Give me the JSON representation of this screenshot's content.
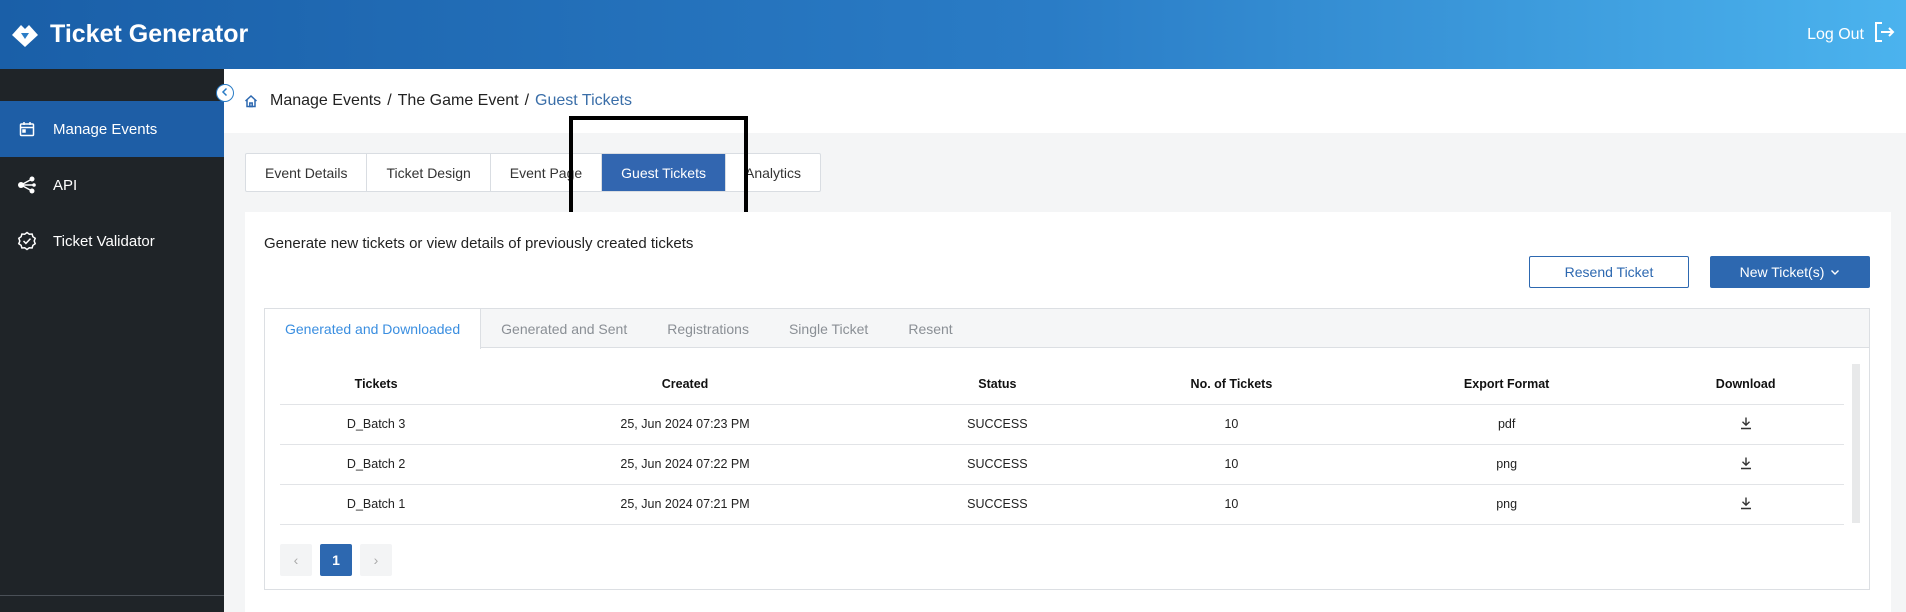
{
  "header": {
    "app_title": "Ticket Generator",
    "logout_label": "Log Out"
  },
  "sidebar": {
    "items": [
      {
        "label": "Manage Events",
        "icon": "calendar-icon",
        "active": true
      },
      {
        "label": "API",
        "icon": "share-nodes-icon",
        "active": false
      },
      {
        "label": "Ticket Validator",
        "icon": "badge-check-icon",
        "active": false
      }
    ]
  },
  "breadcrumb": {
    "part1": "Manage Events",
    "sep1": "/",
    "part2": "The Game Event",
    "sep2": "/",
    "current": "Guest Tickets"
  },
  "tabs": [
    "Event Details",
    "Ticket Design",
    "Event Page",
    "Guest Tickets",
    "Analytics"
  ],
  "active_tab": "Guest Tickets",
  "content": {
    "intro": "Generate new tickets or view details of previously created tickets",
    "resend_label": "Resend Ticket",
    "new_label": "New Ticket(s)"
  },
  "subtabs": [
    "Generated and Downloaded",
    "Generated and Sent",
    "Registrations",
    "Single Ticket",
    "Resent"
  ],
  "table": {
    "headers": [
      "Tickets",
      "Created",
      "Status",
      "No. of Tickets",
      "Export Format",
      "Download"
    ],
    "rows": [
      {
        "ticket": "D_Batch 3",
        "created": "25, Jun 2024 07:23 PM",
        "status": "SUCCESS",
        "count": "10",
        "format": "pdf"
      },
      {
        "ticket": "D_Batch 2",
        "created": "25, Jun 2024 07:22 PM",
        "status": "SUCCESS",
        "count": "10",
        "format": "png"
      },
      {
        "ticket": "D_Batch 1",
        "created": "25, Jun 2024 07:21 PM",
        "status": "SUCCESS",
        "count": "10",
        "format": "png"
      }
    ]
  },
  "pagination": {
    "prev": "‹",
    "current": "1",
    "next": "›"
  },
  "colors": {
    "primary": "#2d68b0",
    "sidebar_bg": "#1f2428",
    "sidebar_active": "#1e5ea6",
    "link": "#3a8ee0"
  }
}
